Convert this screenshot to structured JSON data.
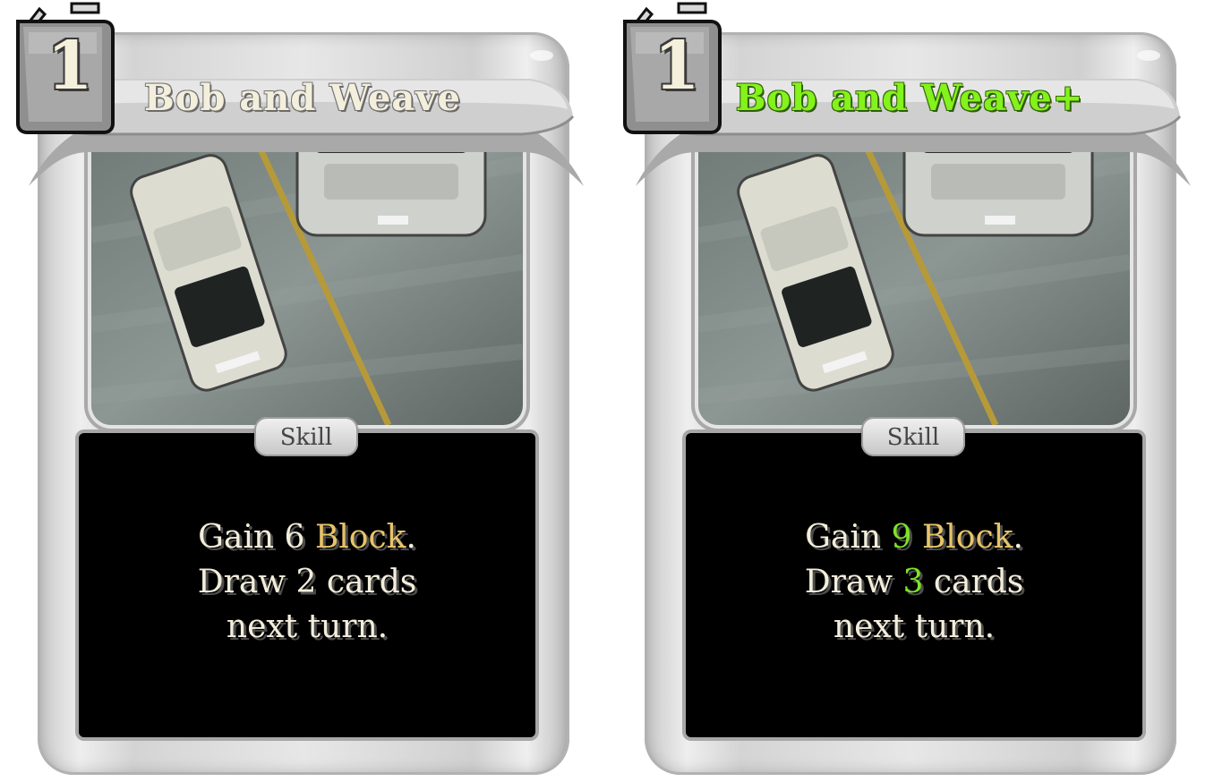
{
  "cards": [
    {
      "cost": "1",
      "title": "Bob and Weave",
      "type": "Skill",
      "description": {
        "line1_prefix": "Gain 6 ",
        "line1_keyword": "Block",
        "line1_suffix": ".",
        "line2": "Draw 2 cards",
        "line3": "next turn."
      }
    },
    {
      "cost": "1",
      "title": "Bob and Weave+",
      "type": "Skill",
      "description": {
        "line1_prefix": "Gain ",
        "line1_upgraded_value": "9",
        "line1_keyword": "Block",
        "line1_suffix": ".",
        "line2_prefix": "Draw ",
        "line2_upgraded_value": "3",
        "line2_suffix": " cards",
        "line3": "next turn."
      }
    }
  ],
  "colors": {
    "title_normal": "#f4efdc",
    "title_upgraded": "#84f21b",
    "keyword": "#e8c468",
    "upgraded_value": "#7ee22a",
    "frame": "#d9d9d9",
    "description_bg": "#000000"
  },
  "icons": {
    "energy": "energy-canister-icon"
  }
}
